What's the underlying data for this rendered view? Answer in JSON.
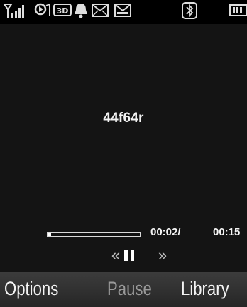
{
  "status_bar": {
    "icons": [
      "signal-icon",
      "music-playing-icon",
      "3d-audio-icon",
      "alarm-icon",
      "message-icon",
      "email-icon",
      "bluetooth-icon",
      "battery-icon"
    ]
  },
  "player": {
    "track_title": "44f64r",
    "progress_fraction": 0.04,
    "time_current": "00:02/",
    "time_total": "00:15"
  },
  "controls": {
    "prev_glyph": "«",
    "next_glyph": "»"
  },
  "softkeys": {
    "left": "Options",
    "center": "Pause",
    "right": "Library"
  }
}
